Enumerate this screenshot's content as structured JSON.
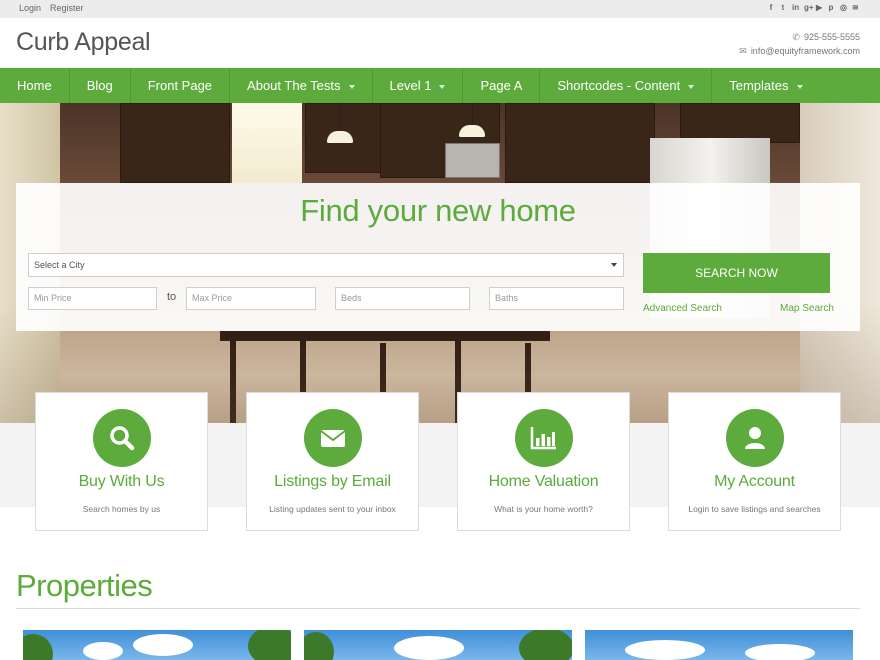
{
  "topbar": {
    "login": "Login",
    "register": "Register",
    "social": [
      {
        "icon": "facebook-icon",
        "glyph": "f"
      },
      {
        "icon": "twitter-icon",
        "glyph": "t"
      },
      {
        "icon": "linkedin-icon",
        "glyph": "in"
      },
      {
        "icon": "google-plus-icon",
        "glyph": "g+"
      },
      {
        "icon": "youtube-icon",
        "glyph": "▶"
      },
      {
        "icon": "pinterest-icon",
        "glyph": "p"
      },
      {
        "icon": "instagram-icon",
        "glyph": "◎"
      },
      {
        "icon": "rss-icon",
        "glyph": "≋"
      }
    ]
  },
  "header": {
    "site_title": "Curb Appeal",
    "phone": "925-555-5555",
    "email": "info@equityframework.com"
  },
  "nav": {
    "items": [
      {
        "label": "Home",
        "dropdown": false
      },
      {
        "label": "Blog",
        "dropdown": false
      },
      {
        "label": "Front Page",
        "dropdown": false
      },
      {
        "label": "About The Tests",
        "dropdown": true
      },
      {
        "label": "Level 1",
        "dropdown": true
      },
      {
        "label": "Page A",
        "dropdown": false
      },
      {
        "label": "Shortcodes - Content",
        "dropdown": true
      },
      {
        "label": "Templates",
        "dropdown": true
      }
    ]
  },
  "search": {
    "title": "Find your new home",
    "city_select": "Select a City",
    "min_price_placeholder": "Min Price",
    "to_label": "to",
    "max_price_placeholder": "Max Price",
    "beds_placeholder": "Beds",
    "baths_placeholder": "Baths",
    "button": "SEARCH NOW",
    "advanced_link": "Advanced Search",
    "map_link": "Map Search"
  },
  "features": [
    {
      "icon": "search-icon",
      "title": "Buy With Us",
      "subtitle": "Search homes by us"
    },
    {
      "icon": "envelope-icon",
      "title": "Listings by Email",
      "subtitle": "Listing updates sent to your inbox"
    },
    {
      "icon": "bar-chart-icon",
      "title": "Home Valuation",
      "subtitle": "What is your home worth?"
    },
    {
      "icon": "user-icon",
      "title": "My Account",
      "subtitle": "Login to save listings and searches"
    }
  ],
  "properties": {
    "heading": "Properties"
  },
  "colors": {
    "accent": "#5cab3c",
    "topbar": "#ececec"
  }
}
